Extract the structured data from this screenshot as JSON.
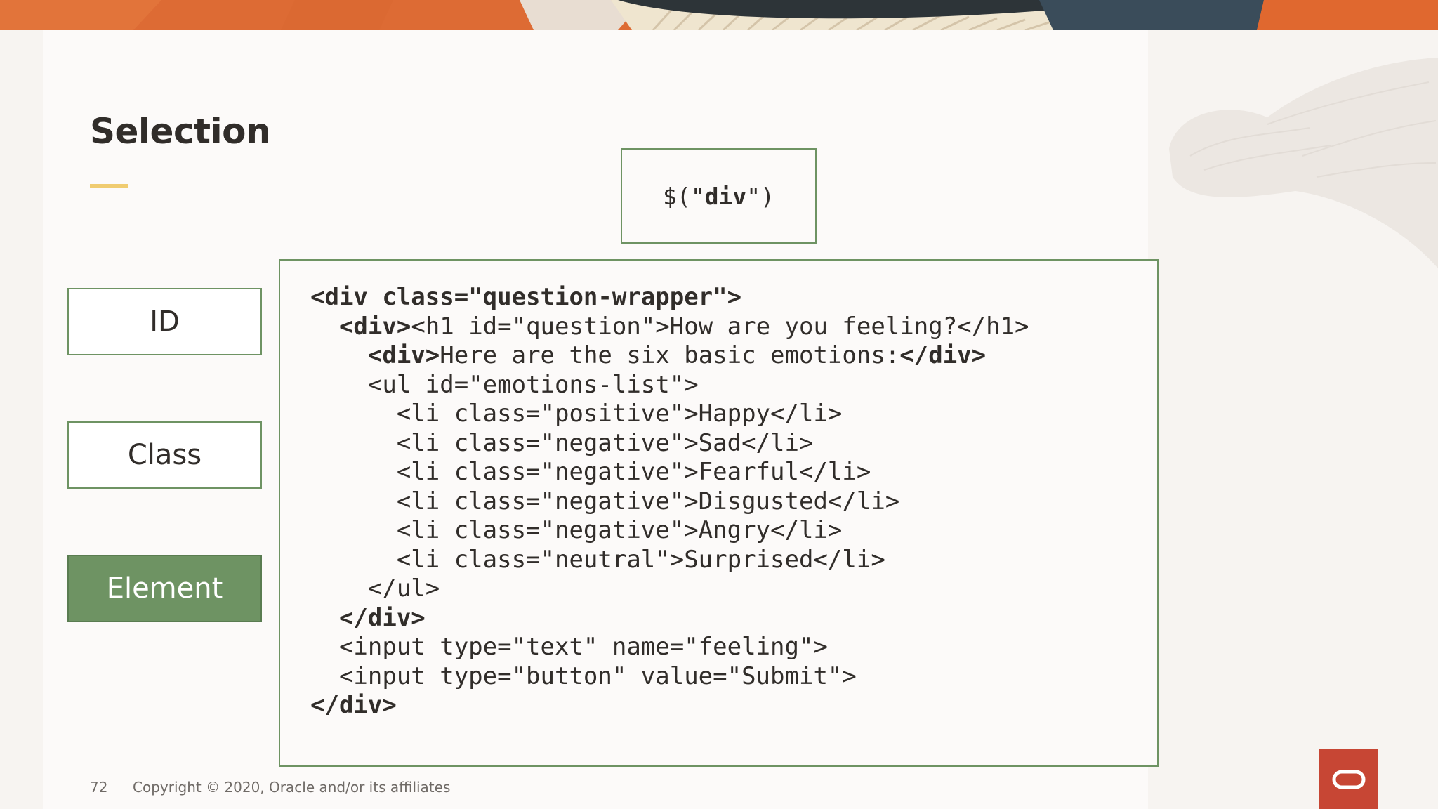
{
  "slide": {
    "title": "Selection",
    "page_number": "72",
    "copyright": "Copyright © 2020, Oracle and/or its affiliates"
  },
  "selector": {
    "prefix": "$(\"",
    "argument": "div",
    "suffix": "\")"
  },
  "selector_types": [
    {
      "label": "ID",
      "active": false
    },
    {
      "label": "Class",
      "active": false
    },
    {
      "label": "Element",
      "active": true
    }
  ],
  "code": [
    [
      {
        "t": "<div class=\"question-wrapper\">",
        "b": true
      }
    ],
    [
      {
        "t": "  "
      },
      {
        "t": "<div>",
        "b": true
      },
      {
        "t": "<h1 id=\"question\">How are you feeling?</h1>"
      }
    ],
    [
      {
        "t": "    "
      },
      {
        "t": "<div>",
        "b": true
      },
      {
        "t": "Here are the six basic emotions:"
      },
      {
        "t": "</div>",
        "b": true
      }
    ],
    [
      {
        "t": "    <ul id=\"emotions-list\">"
      }
    ],
    [
      {
        "t": "      <li class=\"positive\">Happy</li>"
      }
    ],
    [
      {
        "t": "      <li class=\"negative\">Sad</li>"
      }
    ],
    [
      {
        "t": "      <li class=\"negative\">Fearful</li>"
      }
    ],
    [
      {
        "t": "      <li class=\"negative\">Disgusted</li>"
      }
    ],
    [
      {
        "t": "      <li class=\"negative\">Angry</li>"
      }
    ],
    [
      {
        "t": "      <li class=\"neutral\">Surprised</li>"
      }
    ],
    [
      {
        "t": "    </ul>"
      }
    ],
    [
      {
        "t": "  "
      },
      {
        "t": "</div>",
        "b": true
      }
    ],
    [
      {
        "t": "  <input type=\"text\" name=\"feeling\">"
      }
    ],
    [
      {
        "t": "  <input type=\"button\" value=\"Submit\">"
      }
    ],
    [
      {
        "t": "</div>",
        "b": true
      }
    ]
  ],
  "icons": {
    "logo": "oracle-logo-icon",
    "banner": "decorative-banner",
    "feather": "decorative-feather-icon"
  },
  "colors": {
    "accent_green": "#6e9363",
    "underline_yellow": "#f0cc71",
    "oracle_red": "#c74634",
    "banner_orange": "#e2703a",
    "text_dark": "#312d2a"
  }
}
